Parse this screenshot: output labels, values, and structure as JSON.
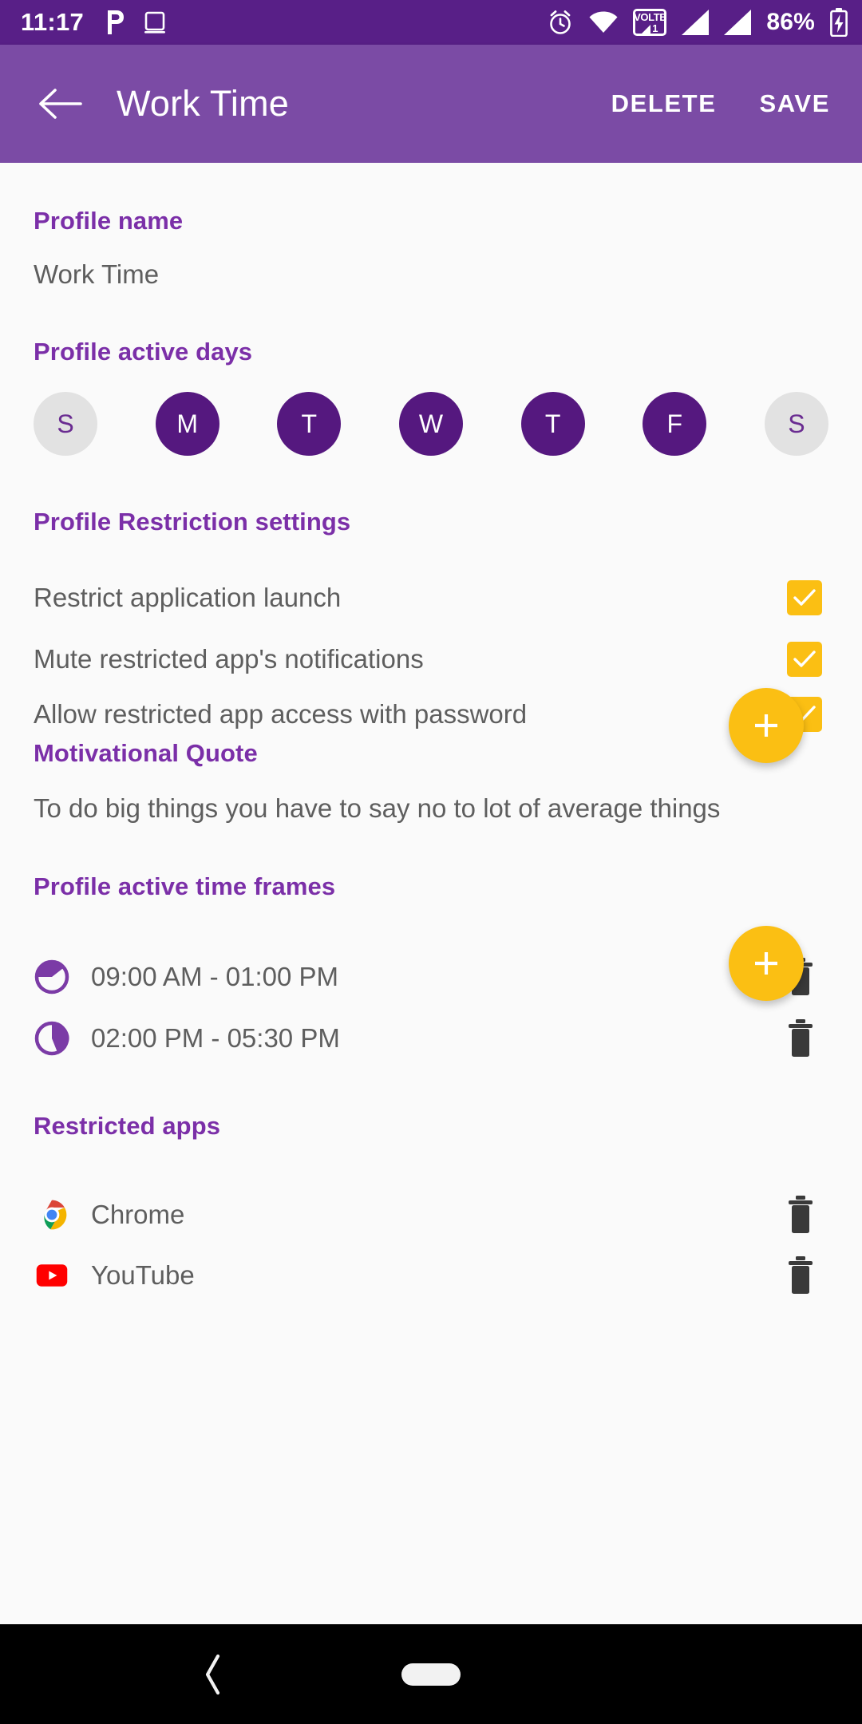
{
  "status_bar": {
    "time": "11:17",
    "left_icons": [
      "parking-p-icon",
      "tablet-icon"
    ],
    "right_icons": [
      "alarm-icon",
      "wifi-icon",
      "volte-icon",
      "signal-1-icon",
      "signal-2-icon"
    ],
    "volte_top_text": "VOLTE",
    "volte_sim_text": "1",
    "battery_percent": "86%",
    "battery_icon": "battery-charging-icon",
    "bg_color": "#581F87"
  },
  "app_bar": {
    "back_icon": "back-arrow-icon",
    "title": "Work Time",
    "delete_label": "DELETE",
    "save_label": "SAVE",
    "bg_color": "#7B4BA5"
  },
  "profile_name": {
    "label": "Profile name",
    "value": "Work Time"
  },
  "active_days": {
    "label": "Profile active days",
    "days": [
      {
        "letter": "S",
        "name": "Sunday",
        "selected": false
      },
      {
        "letter": "M",
        "name": "Monday",
        "selected": true
      },
      {
        "letter": "T",
        "name": "Tuesday",
        "selected": true
      },
      {
        "letter": "W",
        "name": "Wednesday",
        "selected": true
      },
      {
        "letter": "T",
        "name": "Thursday",
        "selected": true
      },
      {
        "letter": "F",
        "name": "Friday",
        "selected": true
      },
      {
        "letter": "S",
        "name": "Saturday",
        "selected": false
      }
    ],
    "selected_color": "#55187F",
    "unselected_color": "#E2E2E2"
  },
  "restriction_settings": {
    "label": "Profile Restriction settings",
    "items": [
      {
        "label": "Restrict application launch",
        "checked": true
      },
      {
        "label": "Mute restricted app's notifications",
        "checked": true
      },
      {
        "label": "Allow restricted app access with password",
        "checked": true
      }
    ],
    "checkbox_color": "#FBBF13"
  },
  "motivational_quote": {
    "label": "Motivational Quote",
    "text": "To do big things you have to say no to lot of average things"
  },
  "time_frames": {
    "label": "Profile active time frames",
    "add_icon": "plus-icon",
    "items": [
      {
        "icon": "pie-clock-icon",
        "range": "09:00 AM  -  01:00 PM",
        "delete_icon": "trash-icon"
      },
      {
        "icon": "pie-clock-icon",
        "range": "02:00 PM  -  05:30 PM",
        "delete_icon": "trash-icon"
      }
    ]
  },
  "restricted_apps": {
    "label": "Restricted apps",
    "add_icon": "plus-icon",
    "items": [
      {
        "icon": "chrome-icon",
        "name": "Chrome",
        "delete_icon": "trash-icon"
      },
      {
        "icon": "youtube-icon",
        "name": "YouTube",
        "delete_icon": "trash-icon"
      }
    ]
  },
  "nav_bar": {
    "back_icon": "nav-back-icon",
    "home_icon": "nav-home-pill-icon"
  },
  "theme": {
    "accent_purple": "#7B2FA8",
    "amber": "#FBBF13",
    "body_text": "#5E5E5E",
    "background": "#FAFAFA"
  }
}
